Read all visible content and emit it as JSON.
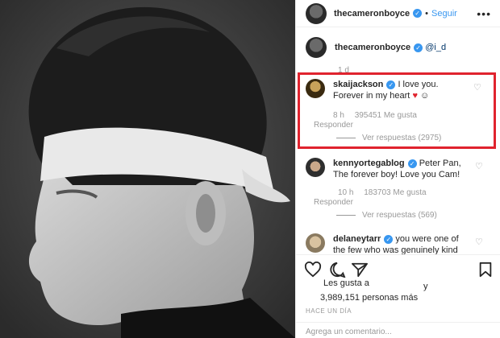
{
  "post": {
    "author": "thecameronboyce",
    "follow_label": "Seguir",
    "dot": "•",
    "more_label": "•••"
  },
  "caption": {
    "username": "thecameronboyce",
    "text": "@i_d",
    "time": "1 d"
  },
  "comments": [
    {
      "username": "skaijackson",
      "text": "I love you. Forever in my heart",
      "time": "8 h",
      "likes": "395451 Me gusta",
      "reply": "Responder",
      "view_replies": "Ver respuestas (2975)"
    },
    {
      "username": "kennyortegablog",
      "text": "Peter Pan, The forever boy! Love you Cam!",
      "time": "10 h",
      "likes": "183703 Me gusta",
      "reply": "Responder",
      "view_replies": "Ver respuestas (569)"
    },
    {
      "username": "delaneytarr",
      "text": "you were one of the few who was genuinely kind"
    }
  ],
  "likes": {
    "line1": "Les gusta a",
    "y": "y",
    "line2": "3,989,151 personas más"
  },
  "timestamp": "HACE UN DÍA",
  "add_comment_placeholder": "Agrega un comentario...",
  "icons": {
    "heart": "heart-icon",
    "comment": "comment-icon",
    "share": "share-icon",
    "save": "bookmark-icon",
    "verified": "verified-icon"
  },
  "colors": {
    "highlight": "#e0232e",
    "link": "#3897f0",
    "verified": "#3897f0",
    "muted": "#999999"
  }
}
